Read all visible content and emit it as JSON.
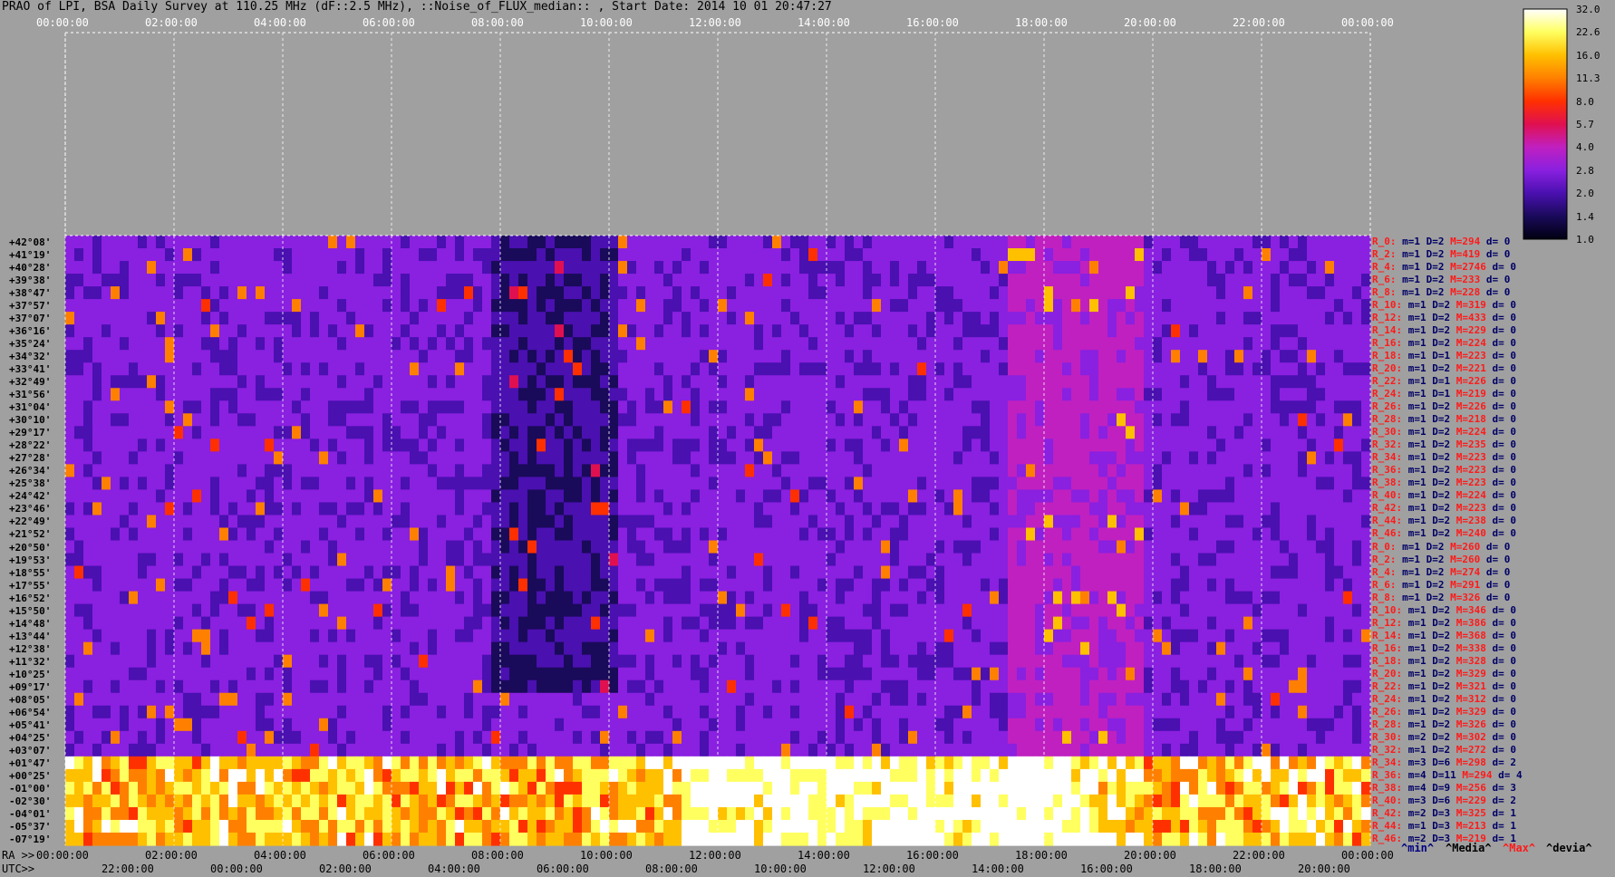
{
  "title": "PRAO of LPI, BSA Daily Survey at 110.25 MHz (dF::2.5 MHz), ::Noise_of_FLUX_median:: , Start Date: 2014 10 01 20:47:27",
  "utc_prefix": "UTC>>",
  "ra_prefix": "RA >>",
  "legend": {
    "min": "^min^",
    "median": "^Media^",
    "max": "^Max^",
    "devia": "^devia^",
    "colors": {
      "min": "#000080",
      "median": "#000000",
      "max": "#ff1a1a",
      "devia": "#000000"
    }
  },
  "chart_data": {
    "type": "heatmap",
    "title": "PRAO of LPI, BSA Daily Survey at 110.25 MHz (dF::2.5 MHz), ::Noise_of_FLUX_median:: , Start Date: 2014 10 01 20:47:27",
    "top_ticks": [
      "00:00:00",
      "02:00:00",
      "04:00:00",
      "06:00:00",
      "08:00:00",
      "10:00:00",
      "12:00:00",
      "14:00:00",
      "16:00:00",
      "18:00:00",
      "20:00:00",
      "22:00:00",
      "00:00:00"
    ],
    "ra_ticks": [
      "00:00:00",
      "02:00:00",
      "04:00:00",
      "06:00:00",
      "08:00:00",
      "10:00:00",
      "12:00:00",
      "14:00:00",
      "16:00:00",
      "18:00:00",
      "20:00:00",
      "22:00:00",
      "00:00:00"
    ],
    "utc_ticks": [
      "22:00:00",
      "00:00:00",
      "02:00:00",
      "04:00:00",
      "06:00:00",
      "08:00:00",
      "10:00:00",
      "12:00:00",
      "14:00:00",
      "16:00:00",
      "18:00:00",
      "20:00:00"
    ],
    "colorbar": {
      "ticks": [
        "32.0",
        "22.6",
        "16.0",
        "11.3",
        "8.0",
        "5.7",
        "4.0",
        "2.8",
        "2.0",
        "1.4",
        "1.0"
      ],
      "scale": "log",
      "colormap": [
        "#000010",
        "#1a0a5a",
        "#4a10b0",
        "#8a20e0",
        "#c020c0",
        "#e01050",
        "#ff3000",
        "#ff8000",
        "#ffc000",
        "#ffff60",
        "#ffffff"
      ]
    },
    "declinations": [
      "+42°08'",
      "+41°19'",
      "+40°28'",
      "+39°38'",
      "+38°47'",
      "+37°57'",
      "+37°07'",
      "+36°16'",
      "+35°24'",
      "+34°32'",
      "+33°41'",
      "+32°49'",
      "+31°56'",
      "+31°04'",
      "+30°10'",
      "+29°17'",
      "+28°22'",
      "+27°28'",
      "+26°34'",
      "+25°38'",
      "+24°42'",
      "+23°46'",
      "+22°49'",
      "+21°52'",
      "+20°50'",
      "+19°53'",
      "+18°55'",
      "+17°55'",
      "+16°52'",
      "+15°50'",
      "+14°48'",
      "+13°44'",
      "+12°38'",
      "+11°32'",
      "+10°25'",
      "+09°17'",
      "+08°05'",
      "+06°54'",
      "+05°41'",
      "+04°25'",
      "+03°07'",
      "+01°47'",
      "+00°25'",
      "-01°00'",
      "-02°30'",
      "-04°01'",
      "-05°37'",
      "-07°19'"
    ],
    "stats": [
      {
        "r": "R_0:",
        "m": "m=1",
        "D": "D=2",
        "M": "M=294",
        "d": "d= 0"
      },
      {
        "r": "R_2:",
        "m": "m=1",
        "D": "D=2",
        "M": "M=419",
        "d": "d= 0"
      },
      {
        "r": "R_4:",
        "m": "m=1",
        "D": "D=2",
        "M": "M=2746",
        "d": "d= 0"
      },
      {
        "r": "R_6:",
        "m": "m=1",
        "D": "D=2",
        "M": "M=233",
        "d": "d= 0"
      },
      {
        "r": "R_8:",
        "m": "m=1",
        "D": "D=2",
        "M": "M=228",
        "d": "d= 0"
      },
      {
        "r": "R_10:",
        "m": "m=1",
        "D": "D=2",
        "M": "M=319",
        "d": "d= 0"
      },
      {
        "r": "R_12:",
        "m": "m=1",
        "D": "D=2",
        "M": "M=433",
        "d": "d= 0"
      },
      {
        "r": "R_14:",
        "m": "m=1",
        "D": "D=2",
        "M": "M=229",
        "d": "d= 0"
      },
      {
        "r": "R_16:",
        "m": "m=1",
        "D": "D=2",
        "M": "M=224",
        "d": "d= 0"
      },
      {
        "r": "R_18:",
        "m": "m=1",
        "D": "D=1",
        "M": "M=223",
        "d": "d= 0"
      },
      {
        "r": "R_20:",
        "m": "m=1",
        "D": "D=2",
        "M": "M=221",
        "d": "d= 0"
      },
      {
        "r": "R_22:",
        "m": "m=1",
        "D": "D=1",
        "M": "M=226",
        "d": "d= 0"
      },
      {
        "r": "R_24:",
        "m": "m=1",
        "D": "D=1",
        "M": "M=219",
        "d": "d= 0"
      },
      {
        "r": "R_26:",
        "m": "m=1",
        "D": "D=2",
        "M": "M=226",
        "d": "d= 0"
      },
      {
        "r": "R_28:",
        "m": "m=1",
        "D": "D=2",
        "M": "M=218",
        "d": "d= 0"
      },
      {
        "r": "R_30:",
        "m": "m=1",
        "D": "D=2",
        "M": "M=224",
        "d": "d= 0"
      },
      {
        "r": "R_32:",
        "m": "m=1",
        "D": "D=2",
        "M": "M=235",
        "d": "d= 0"
      },
      {
        "r": "R_34:",
        "m": "m=1",
        "D": "D=2",
        "M": "M=223",
        "d": "d= 0"
      },
      {
        "r": "R_36:",
        "m": "m=1",
        "D": "D=2",
        "M": "M=223",
        "d": "d= 0"
      },
      {
        "r": "R_38:",
        "m": "m=1",
        "D": "D=2",
        "M": "M=223",
        "d": "d= 0"
      },
      {
        "r": "R_40:",
        "m": "m=1",
        "D": "D=2",
        "M": "M=224",
        "d": "d= 0"
      },
      {
        "r": "R_42:",
        "m": "m=1",
        "D": "D=2",
        "M": "M=223",
        "d": "d= 0"
      },
      {
        "r": "R_44:",
        "m": "m=1",
        "D": "D=2",
        "M": "M=238",
        "d": "d= 0"
      },
      {
        "r": "R_46:",
        "m": "m=1",
        "D": "D=2",
        "M": "M=240",
        "d": "d= 0"
      },
      {
        "r": "R_0:",
        "m": "m=1",
        "D": "D=2",
        "M": "M=260",
        "d": "d= 0"
      },
      {
        "r": "R_2:",
        "m": "m=1",
        "D": "D=2",
        "M": "M=260",
        "d": "d= 0"
      },
      {
        "r": "R_4:",
        "m": "m=1",
        "D": "D=2",
        "M": "M=274",
        "d": "d= 0"
      },
      {
        "r": "R_6:",
        "m": "m=1",
        "D": "D=2",
        "M": "M=291",
        "d": "d= 0"
      },
      {
        "r": "R_8:",
        "m": "m=1",
        "D": "D=2",
        "M": "M=326",
        "d": "d= 0"
      },
      {
        "r": "R_10:",
        "m": "m=1",
        "D": "D=2",
        "M": "M=346",
        "d": "d= 0"
      },
      {
        "r": "R_12:",
        "m": "m=1",
        "D": "D=2",
        "M": "M=386",
        "d": "d= 0"
      },
      {
        "r": "R_14:",
        "m": "m=1",
        "D": "D=2",
        "M": "M=368",
        "d": "d= 0"
      },
      {
        "r": "R_16:",
        "m": "m=1",
        "D": "D=2",
        "M": "M=338",
        "d": "d= 0"
      },
      {
        "r": "R_18:",
        "m": "m=1",
        "D": "D=2",
        "M": "M=328",
        "d": "d= 0"
      },
      {
        "r": "R_20:",
        "m": "m=1",
        "D": "D=2",
        "M": "M=329",
        "d": "d= 0"
      },
      {
        "r": "R_22:",
        "m": "m=1",
        "D": "D=2",
        "M": "M=321",
        "d": "d= 0"
      },
      {
        "r": "R_24:",
        "m": "m=1",
        "D": "D=2",
        "M": "M=312",
        "d": "d= 0"
      },
      {
        "r": "R_26:",
        "m": "m=1",
        "D": "D=2",
        "M": "M=329",
        "d": "d= 0"
      },
      {
        "r": "R_28:",
        "m": "m=1",
        "D": "D=2",
        "M": "M=326",
        "d": "d= 0"
      },
      {
        "r": "R_30:",
        "m": "m=2",
        "D": "D=2",
        "M": "M=302",
        "d": "d= 0"
      },
      {
        "r": "R_32:",
        "m": "m=1",
        "D": "D=2",
        "M": "M=272",
        "d": "d= 0"
      },
      {
        "r": "R_34:",
        "m": "m=3",
        "D": "D=6",
        "M": "M=298",
        "d": "d= 2"
      },
      {
        "r": "R_36:",
        "m": "m=4",
        "D": "D=11",
        "M": "M=294",
        "d": "d= 4"
      },
      {
        "r": "R_38:",
        "m": "m=4",
        "D": "D=9",
        "M": "M=256",
        "d": "d= 3"
      },
      {
        "r": "R_40:",
        "m": "m=3",
        "D": "D=6",
        "M": "M=229",
        "d": "d= 2"
      },
      {
        "r": "R_42:",
        "m": "m=2",
        "D": "D=3",
        "M": "M=325",
        "d": "d= 1"
      },
      {
        "r": "R_44:",
        "m": "m=1",
        "D": "D=3",
        "M": "M=213",
        "d": "d= 1"
      },
      {
        "r": "R_46:",
        "m": "m=2",
        "D": "D=3",
        "M": "M=219",
        "d": "d= 1"
      }
    ]
  }
}
